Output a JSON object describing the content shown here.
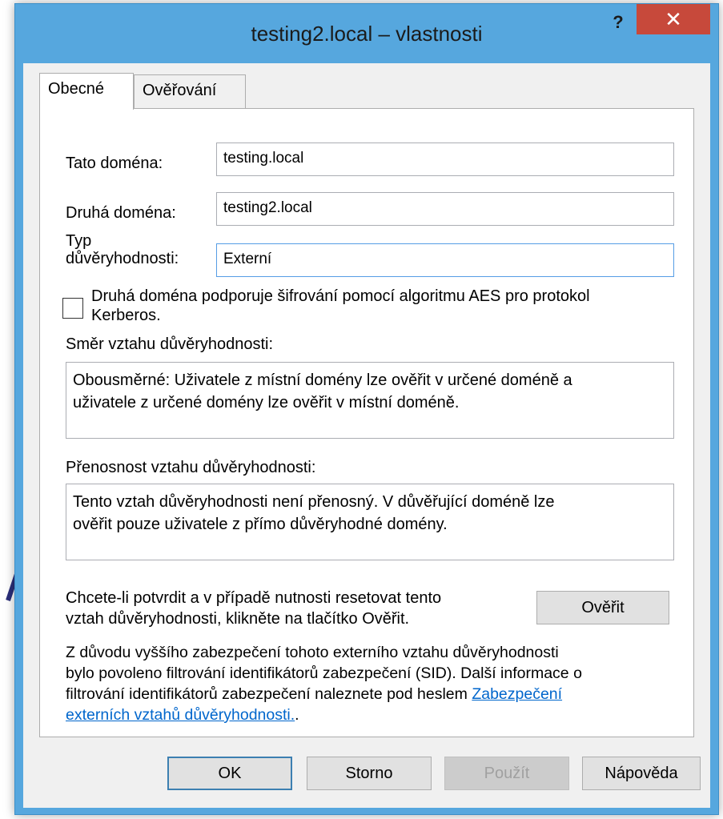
{
  "window": {
    "title": "testing2.local – vlastnosti",
    "help_glyph": "?",
    "close_glyph": "✕"
  },
  "tabs": [
    {
      "label": "Obecné",
      "active": true
    },
    {
      "label": "Ověřování",
      "active": false
    }
  ],
  "form": {
    "this_domain_label": "Tato doména:",
    "this_domain_value": "testing.local",
    "other_domain_label": "Druhá doména:",
    "other_domain_value": "testing2.local",
    "trust_type_label_line1": "Typ",
    "trust_type_label_line2": "důvěryhodnosti:",
    "trust_type_value": "Externí",
    "aes_checkbox_line1": "Druhá doména podporuje šifrování pomocí algoritmu AES pro protokol",
    "aes_checkbox_line2": "Kerberos.",
    "aes_checked": false,
    "direction_label": "Směr vztahu důvěryhodnosti:",
    "direction_line1": "Obousměrné: Uživatele z místní domény lze ověřit v určené doméně a",
    "direction_line2": "uživatele z určené domény lze ověřit v místní doméně.",
    "transitivity_label": "Přenosnost vztahu důvěryhodnosti:",
    "transitivity_line1": "Tento vztah důvěryhodnosti není přenosný. V důvěřující doméně lze",
    "transitivity_line2": "ověřit pouze uživatele z přímo důvěryhodné domény.",
    "validate_text_line1": "Chcete-li potvrdit a v případě nutnosti resetovat tento",
    "validate_text_line2": "vztah důvěryhodnosti, klikněte na tlačítko Ověřit.",
    "validate_button": "Ověřit",
    "sid_line1": "Z důvodu vyššího zabezpečení tohoto externího vztahu důvěryhodnosti",
    "sid_line2": "bylo povoleno filtrování identifikátorů zabezpečení (SID). Další informace o",
    "sid_line3_prefix": "filtrování identifikátorů zabezpečení naleznete pod heslem ",
    "sid_link_part1": "Zabezpečení",
    "sid_link_part2": "externích vztahů důvěryhodnosti.",
    "sid_suffix": "."
  },
  "buttons": {
    "ok": "OK",
    "cancel": "Storno",
    "apply": "Použít",
    "help": "Nápověda"
  }
}
